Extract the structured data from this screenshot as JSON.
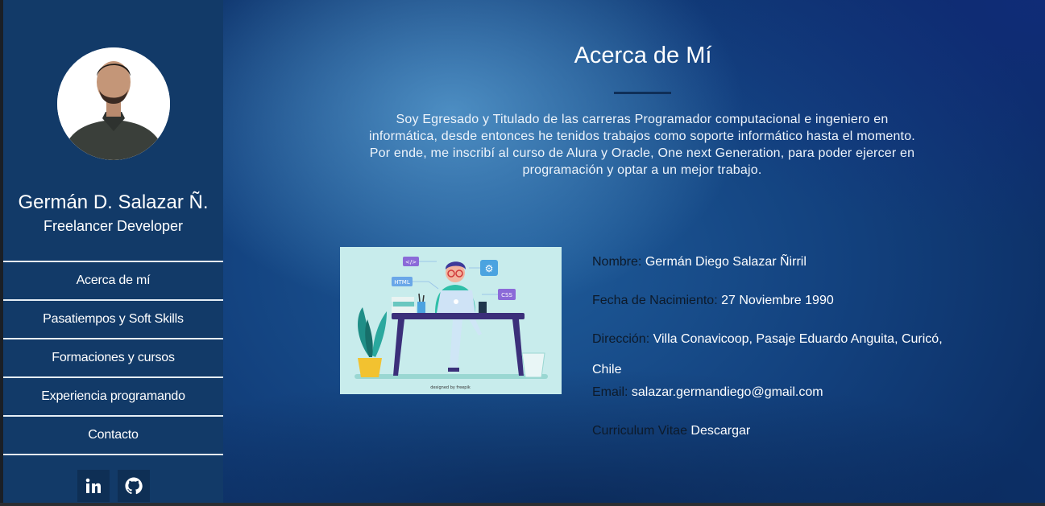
{
  "sidebar": {
    "name": "Germán D. Salazar Ñ.",
    "role": "Freelancer Developer",
    "nav": [
      {
        "label": "Acerca de mí"
      },
      {
        "label": "Pasatiempos y Soft Skills"
      },
      {
        "label": "Formaciones y cursos"
      },
      {
        "label": "Experiencia programando"
      },
      {
        "label": "Contacto"
      }
    ],
    "social": [
      {
        "icon": "linkedin-icon"
      },
      {
        "icon": "github-icon"
      }
    ]
  },
  "about": {
    "title": "Acerca de Mí",
    "intro": "Soy Egresado y Titulado de las carreras Programador computacional e ingeniero en informática, desde entonces he tenidos trabajos como soporte informático hasta el momento. Por ende, me inscribí al curso de Alura y Oracle, One next Generation, para poder ejercer en programación y optar a un mejor trabajo.",
    "illustration": {
      "labels": [
        "</>",
        "HTML",
        "CSS",
        "⚙"
      ],
      "credit": "designed by freepik"
    },
    "info": {
      "name_label": "Nombre:",
      "name_value": "Germán Diego Salazar Ñirril",
      "birth_label": "Fecha de Nacimiento:",
      "birth_value": "27 Noviembre 1990",
      "address_label": "Dirección:",
      "address_value": "Villa Conavicoop, Pasaje Eduardo Anguita, Curicó,",
      "address_value2": "Chile",
      "email_label": "Email:",
      "email_value": "salazar.germandiego@gmail.com",
      "cv_label": "Curriculum Vitae",
      "cv_link": "Descargar"
    }
  },
  "colors": {
    "sidebar_bg": "#123a68",
    "accent_dark": "#0f2f58",
    "text_light": "#ffffff"
  }
}
